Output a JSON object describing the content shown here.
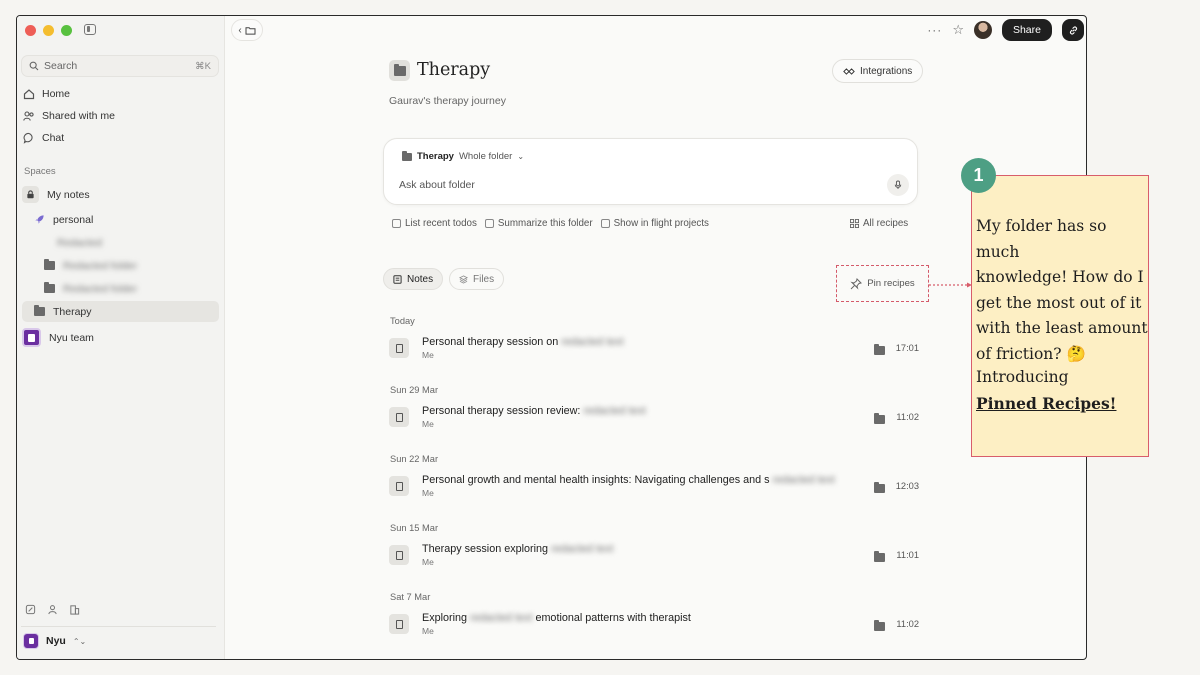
{
  "sidebar": {
    "search_placeholder": "Search",
    "search_shortcut": "⌘K",
    "nav": [
      {
        "label": "Home",
        "icon": "home-icon"
      },
      {
        "label": "Shared with me",
        "icon": "people-icon"
      },
      {
        "label": "Chat",
        "icon": "chat-icon"
      }
    ],
    "spaces_label": "Spaces",
    "my_notes": "My notes",
    "personal": "personal",
    "blurred_items": [
      "Redacted",
      "Redacted folder",
      "Redacted folder"
    ],
    "therapy": "Therapy",
    "team": "Nyu team",
    "workspace": "Nyu"
  },
  "header": {
    "share_label": "Share"
  },
  "page": {
    "title": "Therapy",
    "subtitle": "Gaurav's therapy journey",
    "integrations_label": "Integrations"
  },
  "ask": {
    "scope_folder": "Therapy",
    "scope_mode": "Whole folder",
    "placeholder": "Ask about folder"
  },
  "suggestions": [
    "List recent todos",
    "Summarize this folder",
    "Show in flight projects"
  ],
  "all_recipes": "All recipes",
  "tabs": {
    "notes": "Notes",
    "files": "Files"
  },
  "pin_recipes": "Pin recipes",
  "notes": [
    {
      "date": "Today",
      "title": "Personal therapy session on",
      "blurred": "redacted text",
      "author": "Me",
      "time": "17:01"
    },
    {
      "date": "Sun 29 Mar",
      "title": "Personal therapy session review:",
      "blurred": "redacted text",
      "author": "Me",
      "time": "11:02"
    },
    {
      "date": "Sun 22 Mar",
      "title": "Personal growth and mental health insights: Navigating challenges and s",
      "blurred": "redacted text",
      "author": "Me",
      "time": "12:03"
    },
    {
      "date": "Sun 15 Mar",
      "title": "Therapy session exploring",
      "blurred": "redacted text",
      "author": "Me",
      "time": "11:01"
    },
    {
      "date": "Sat 7 Mar",
      "title": "Exploring",
      "blurred": "redacted text",
      "title_after": "emotional patterns with therapist",
      "author": "Me",
      "time": "11:02"
    }
  ],
  "annotation": {
    "step": "1",
    "lines": [
      "My folder has so much",
      "knowledge! How do I",
      "get the most out of it",
      "with the least amount",
      "of  friction? 🤔"
    ],
    "intro": "Introducing",
    "feature": "Pinned Recipes!"
  },
  "colors": {
    "accent_green": "#4d9f84",
    "callout_bg": "#fdefc4",
    "callout_border": "#d85d6b",
    "team_purple": "#6b2fa0"
  }
}
